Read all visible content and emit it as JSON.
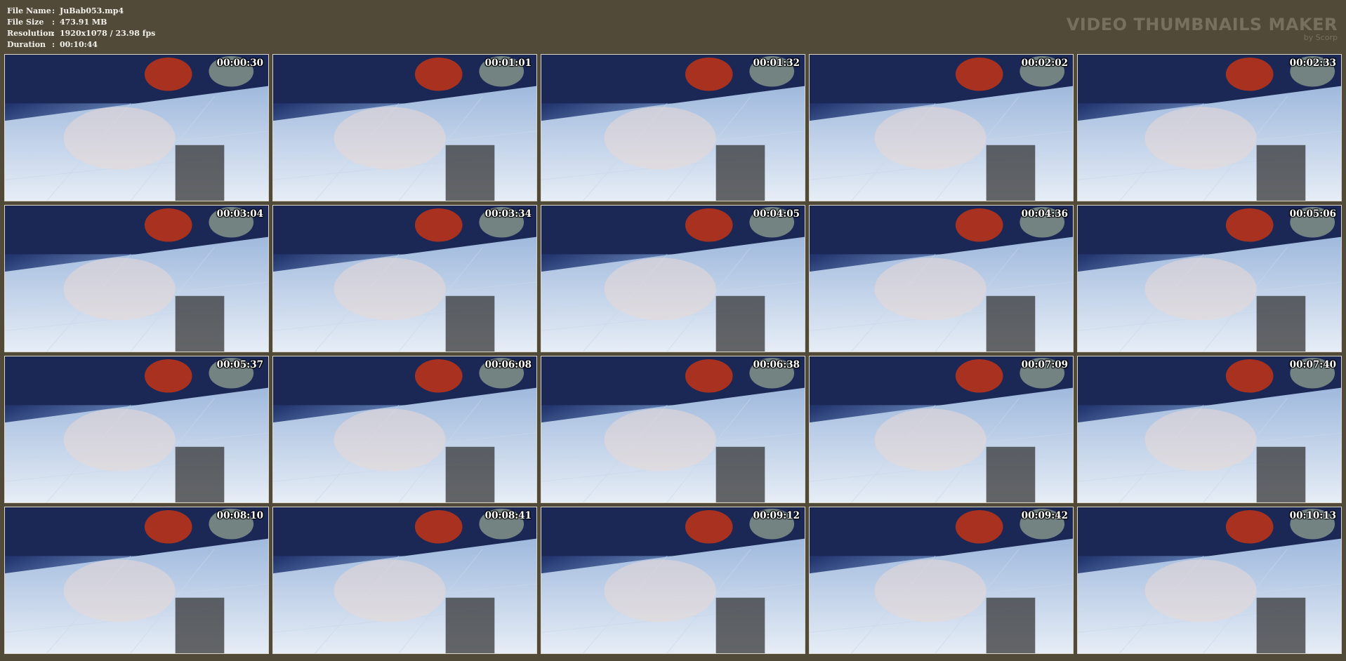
{
  "info": [
    {
      "key": "File Name",
      "sep": ":",
      "value": "JuBab053.mp4"
    },
    {
      "key": "File Size",
      "sep": ":",
      "value": "473.91 MB"
    },
    {
      "key": "Resolution",
      "sep": ":",
      "value": "1920x1078 / 23.98 fps"
    },
    {
      "key": "Duration",
      "sep": ":",
      "value": "00:10:44"
    }
  ],
  "brand": {
    "title": "VIDEO THUMBNAILS MAKER",
    "subtitle": "by Scorp"
  },
  "thumbnails": [
    {
      "timestamp": "00:00:30"
    },
    {
      "timestamp": "00:01:01"
    },
    {
      "timestamp": "00:01:32"
    },
    {
      "timestamp": "00:02:02"
    },
    {
      "timestamp": "00:02:33"
    },
    {
      "timestamp": "00:03:04"
    },
    {
      "timestamp": "00:03:34"
    },
    {
      "timestamp": "00:04:05"
    },
    {
      "timestamp": "00:04:36"
    },
    {
      "timestamp": "00:05:06"
    },
    {
      "timestamp": "00:05:37"
    },
    {
      "timestamp": "00:06:08"
    },
    {
      "timestamp": "00:06:38"
    },
    {
      "timestamp": "00:07:09"
    },
    {
      "timestamp": "00:07:40"
    },
    {
      "timestamp": "00:08:10"
    },
    {
      "timestamp": "00:08:41"
    },
    {
      "timestamp": "00:09:12"
    },
    {
      "timestamp": "00:09:42"
    },
    {
      "timestamp": "00:10:13"
    }
  ],
  "colors": {
    "background": "#514a39",
    "brand_text": "#77705e",
    "info_text": "#f4f1ea"
  }
}
